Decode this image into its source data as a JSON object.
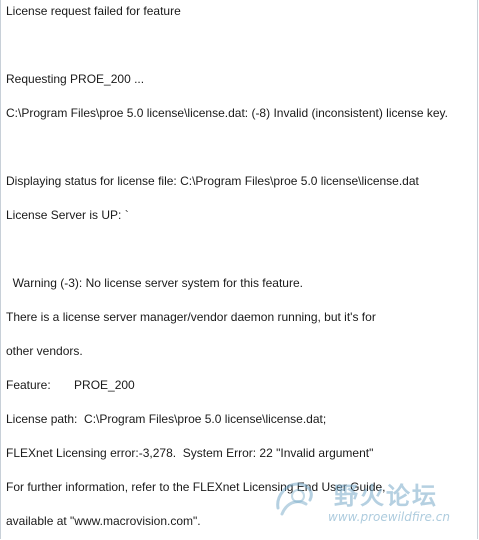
{
  "message": {
    "lines": [
      "License request failed for feature",
      "Requesting PROE_200 ...",
      "C:\\Program Files\\proe 5.0 license\\license.dat: (-8) Invalid (inconsistent) license key.",
      "Displaying status for license file: C:\\Program Files\\proe 5.0 license\\license.dat",
      "License Server is UP: `",
      "  Warning (-3): No license server system for this feature.",
      "There is a license server manager/vendor daemon running, but it's for",
      "other vendors.",
      "Feature:       PROE_200",
      "License path:  C:\\Program Files\\proe 5.0 license\\license.dat;",
      "FLEXnet Licensing error:-3,278.  System Error: 22 \"Invalid argument\"",
      "For further information, refer to the FLEXnet Licensing End User Guide,",
      "available at \"www.macrovision.com\"."
    ]
  },
  "watermark": {
    "title": "野火论坛",
    "url": "www.proewildfire.cn",
    "color": "#7aaac8"
  }
}
